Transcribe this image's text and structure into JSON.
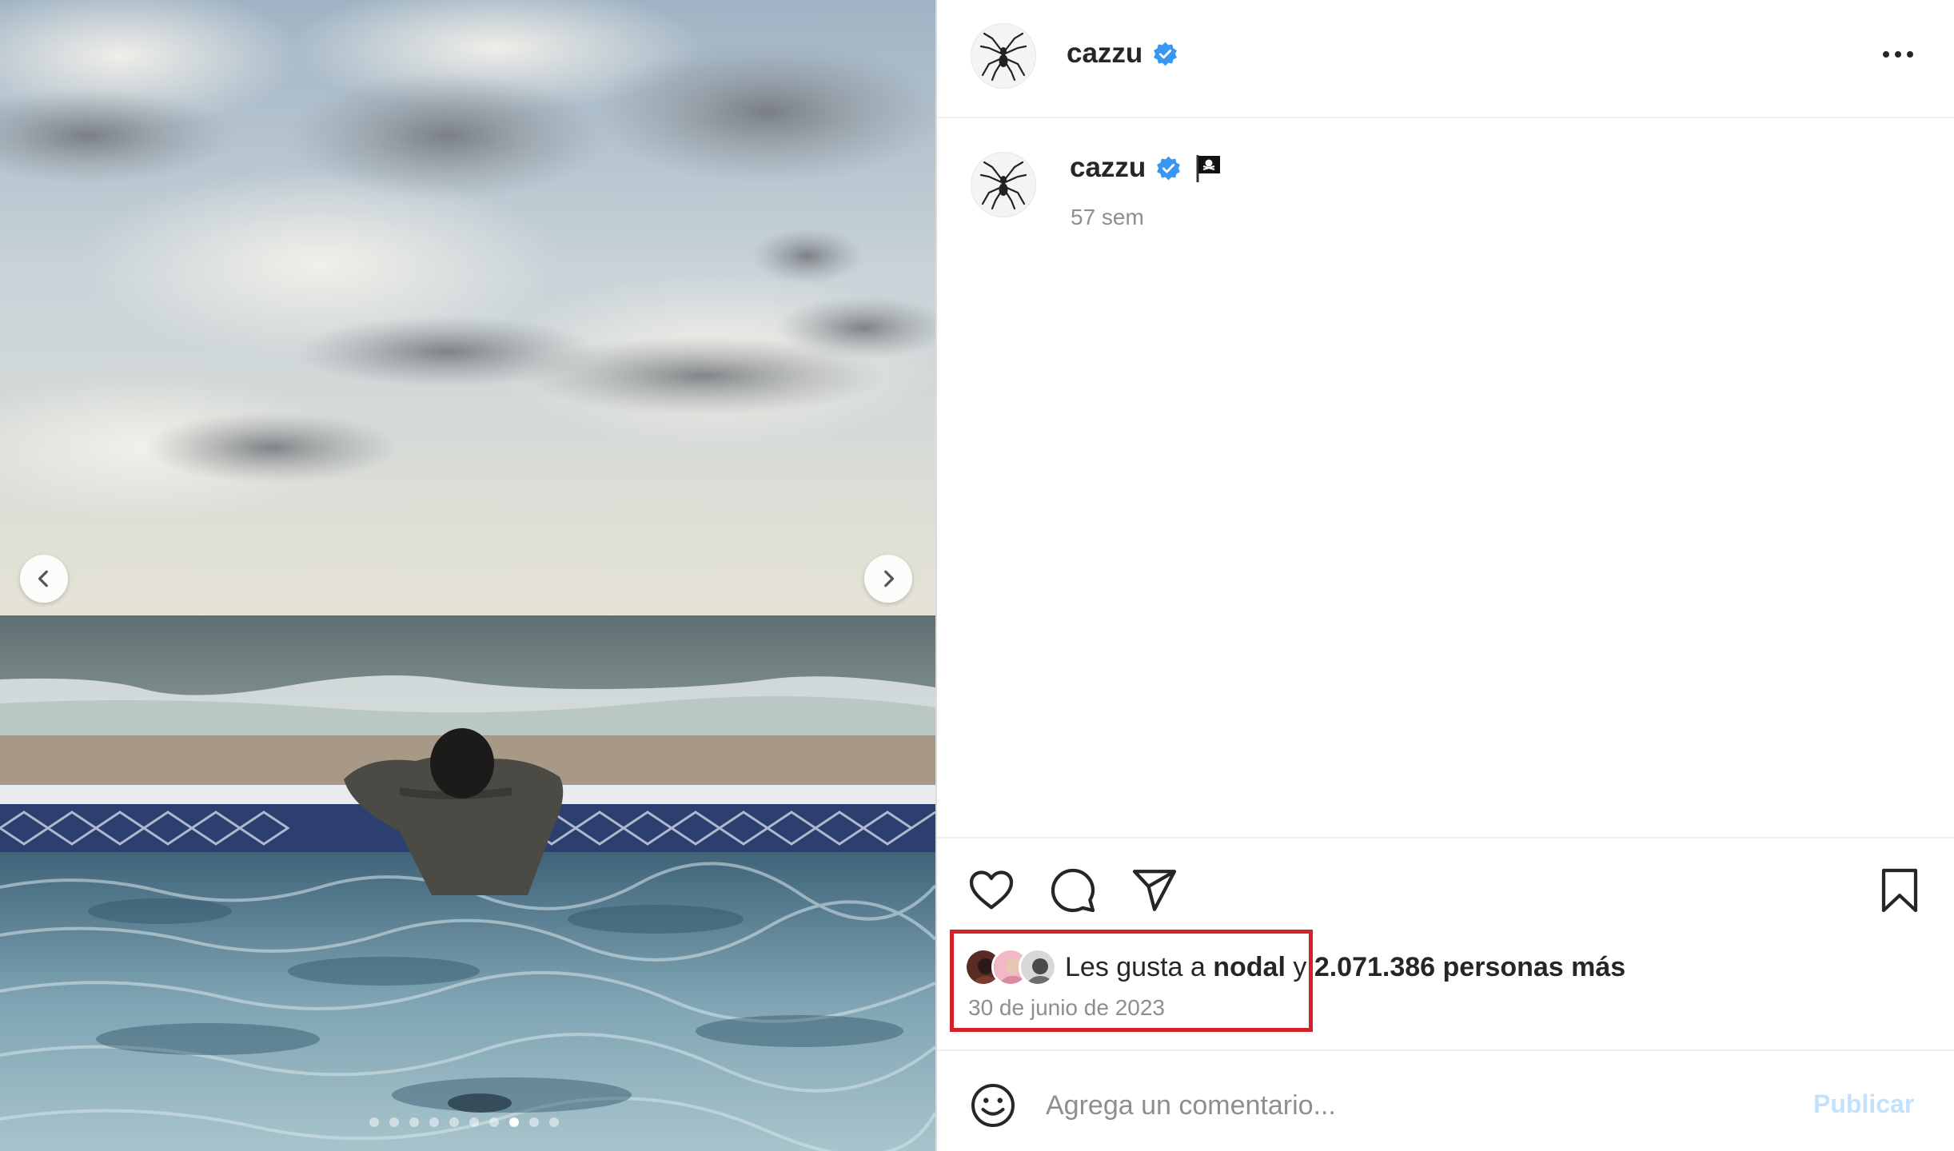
{
  "post": {
    "author": {
      "username": "cazzu",
      "verified": true,
      "avatar_icon": "spider-icon"
    },
    "caption": {
      "username": "cazzu",
      "emoji": "🏴‍☠️",
      "time_ago": "57 sem"
    },
    "media": {
      "prev_icon": "chevron-left-icon",
      "next_icon": "chevron-right-icon",
      "slide_count": 10,
      "active_slide": 8
    },
    "actions": {
      "like_icon": "heart-icon",
      "comment_icon": "comment-icon",
      "share_icon": "paper-plane-icon",
      "save_icon": "bookmark-icon"
    },
    "likes": {
      "prefix": "Les gusta a ",
      "liker": "nodal",
      "middle": " y ",
      "count_text": "2.071.386 personas más"
    },
    "date": "30 de junio de 2023",
    "comment_box": {
      "emoji_icon": "smiley-icon",
      "placeholder": "Agrega un comentario...",
      "publish_label": "Publicar"
    }
  },
  "colors": {
    "verified_badge": "#3897f0",
    "highlight_box": "#d1232a",
    "publish_disabled": "#c3e1fc",
    "secondary_text": "#8e8e8e"
  }
}
